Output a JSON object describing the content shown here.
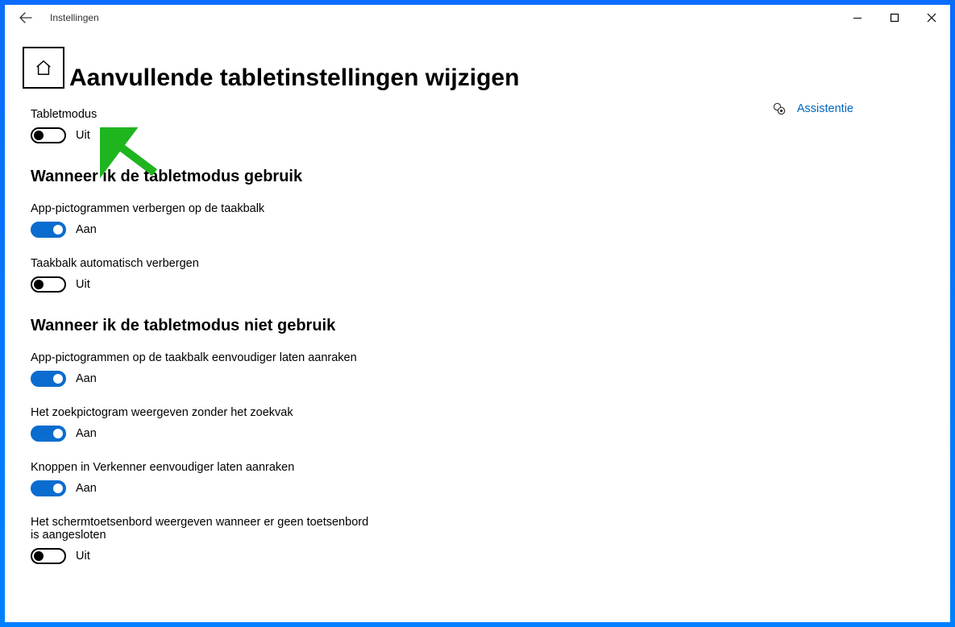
{
  "titlebar": {
    "app_name": "Instellingen"
  },
  "header": {
    "title": "Aanvullende tabletinstellingen wijzigen"
  },
  "tablet_mode": {
    "label": "Tabletmodus",
    "state": "Uit"
  },
  "section_when_using": {
    "heading": "Wanneer ik de tabletmodus gebruik",
    "hide_app_icons": {
      "label": "App-pictogrammen verbergen op de taakbalk",
      "state": "Aan"
    },
    "auto_hide_taskbar": {
      "label": "Taakbalk automatisch verbergen",
      "state": "Uit"
    }
  },
  "section_when_not_using": {
    "heading": "Wanneer ik de tabletmodus niet gebruik",
    "touch_icons": {
      "label": "App-pictogrammen op de taakbalk eenvoudiger laten aanraken",
      "state": "Aan"
    },
    "search_icon": {
      "label": "Het zoekpictogram weergeven zonder het zoekvak",
      "state": "Aan"
    },
    "explorer_buttons": {
      "label": "Knoppen in Verkenner eenvoudiger laten aanraken",
      "state": "Aan"
    },
    "osk": {
      "label": "Het schermtoetsenbord weergeven wanneer er geen toetsenbord is aangesloten",
      "state": "Uit"
    }
  },
  "assist": {
    "label": "Assistentie"
  }
}
